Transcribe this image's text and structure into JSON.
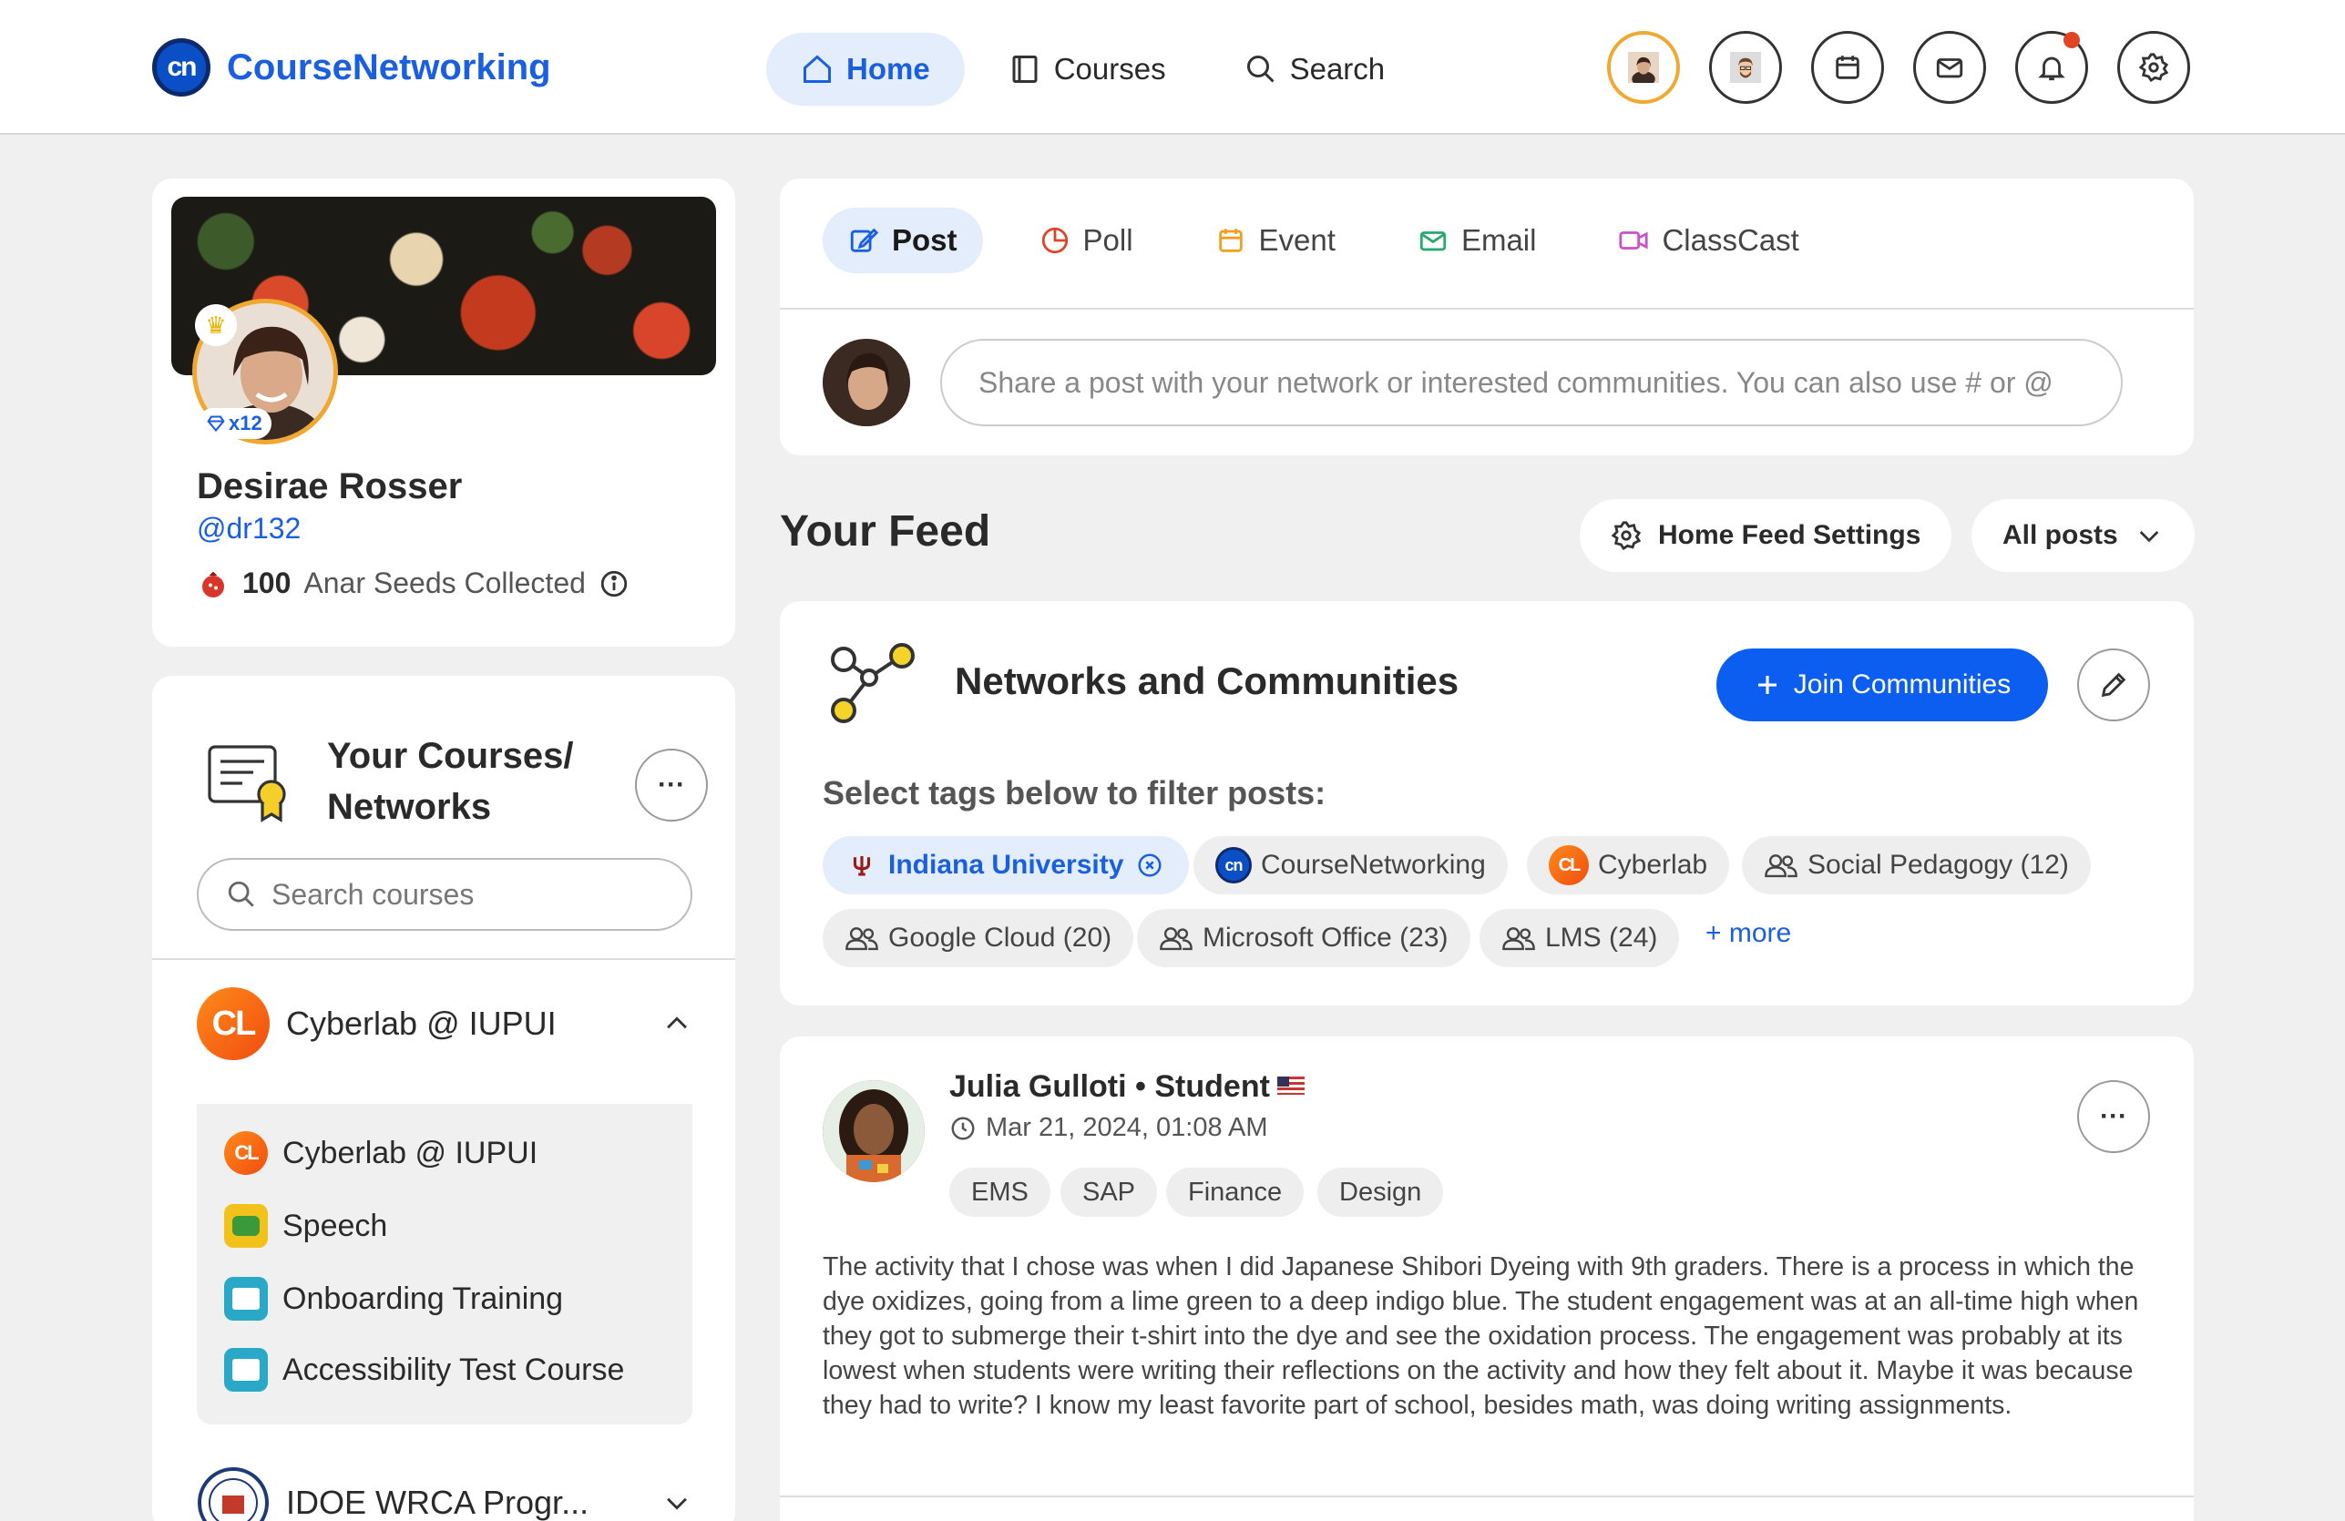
{
  "brand": {
    "name": "CourseNetworking",
    "mark": "cn"
  },
  "nav": {
    "home": "Home",
    "courses": "Courses",
    "search": "Search"
  },
  "profile": {
    "name": "Desirae Rosser",
    "handle": "@dr132",
    "gem_count": "x12",
    "seeds_count": "100",
    "seeds_label": "Anar Seeds Collected"
  },
  "courses_panel": {
    "title": "Your Courses/ Networks",
    "search_placeholder": "Search courses",
    "group": "Cyberlab @ IUPUI",
    "items": [
      {
        "label": "Cyberlab @ IUPUI"
      },
      {
        "label": "Speech"
      },
      {
        "label": "Onboarding Training"
      },
      {
        "label": "Accessibility Test Course"
      }
    ],
    "group2": "IDOE WRCA Progr..."
  },
  "compose": {
    "tabs": [
      "Post",
      "Poll",
      "Event",
      "Email",
      "ClassCast"
    ],
    "placeholder": "Share a post with your network or interested communities. You can also use # or @"
  },
  "feed": {
    "title": "Your Feed",
    "settings_label": "Home Feed Settings",
    "filter_label": "All posts"
  },
  "networks": {
    "title": "Networks and Communities",
    "join_label": "Join Communities",
    "filter_prompt": "Select tags below to filter posts:",
    "tags": [
      "Indiana University",
      "CourseNetworking",
      "Cyberlab",
      "Social Pedagogy (12)",
      "Google Cloud (20)",
      "Microsoft Office (23)",
      "LMS (24)"
    ],
    "more_label": "+ more"
  },
  "post": {
    "author": "Julia Gulloti • Student",
    "time": "Mar 21, 2024, 01:08 AM",
    "tags": [
      "EMS",
      "SAP",
      "Finance",
      "Design"
    ],
    "body": "The activity that I chose was when I did Japanese Shibori Dyeing with 9th graders. There is a process in which the dye oxidizes, going from a lime green to a deep indigo blue. The student engagement was at an all-time high when they got to submerge their t-shirt into the dye and see the oxidation process. The engagement was probably at its lowest when students were writing their reflections on the activity and how they felt about it. Maybe it was because they had to write? I know my least favorite part of school, besides math, was doing writing assignments."
  },
  "colors": {
    "accent": "#1a5fe0",
    "join_button": "#0b5ef0",
    "avatar_ring": "#f0a830",
    "notification": "#e04420"
  }
}
